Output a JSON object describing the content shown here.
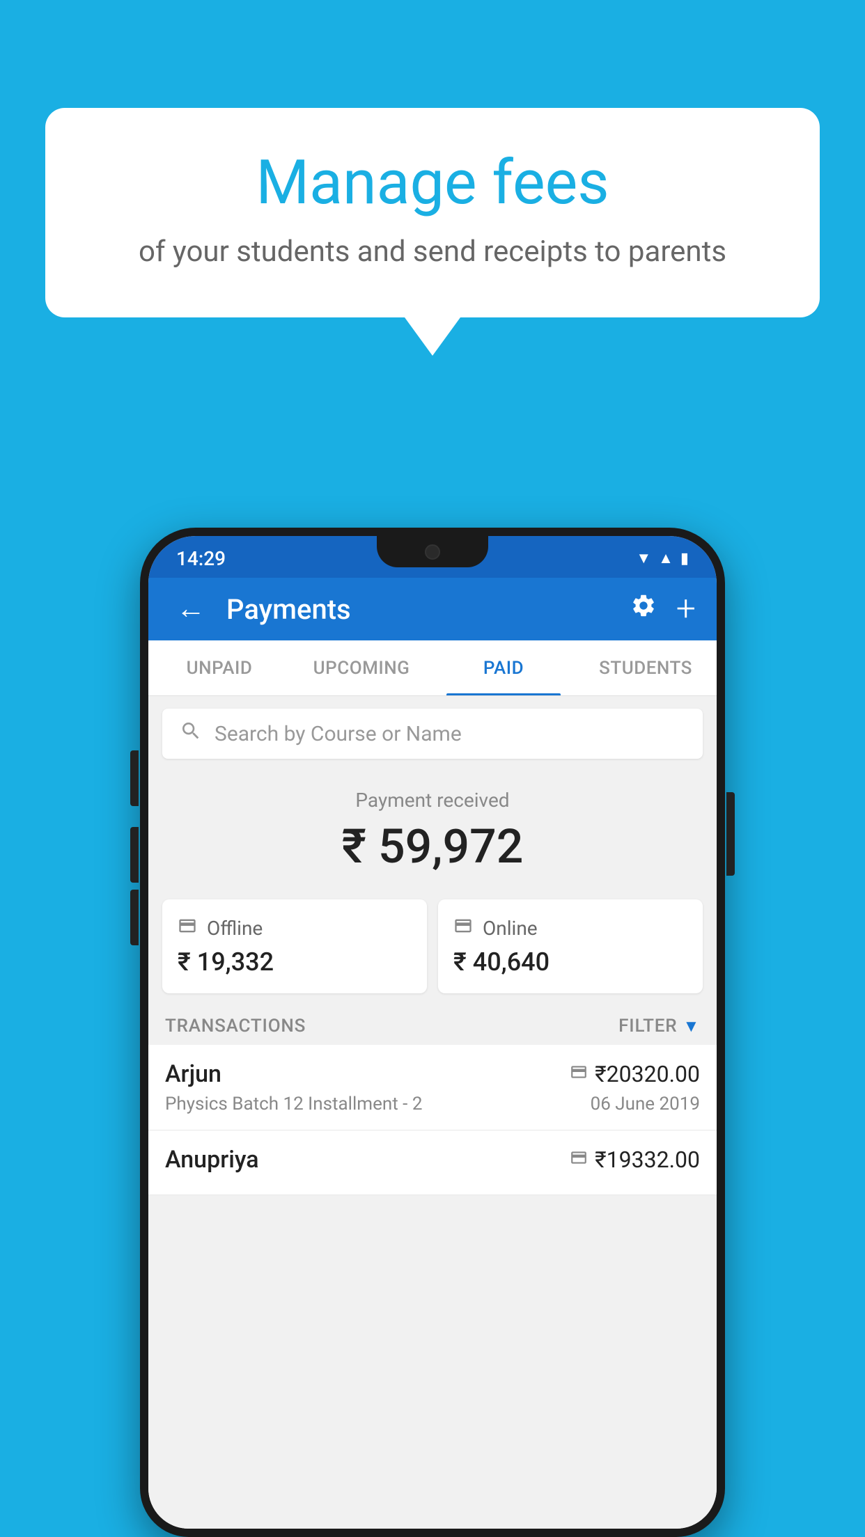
{
  "background_color": "#1AAFE3",
  "speech_bubble": {
    "title": "Manage fees",
    "subtitle": "of your students and send receipts to parents"
  },
  "phone": {
    "status_bar": {
      "time": "14:29"
    },
    "app_bar": {
      "title": "Payments",
      "back_label": "←",
      "settings_label": "⚙",
      "add_label": "+"
    },
    "tabs": [
      {
        "label": "UNPAID",
        "active": false
      },
      {
        "label": "UPCOMING",
        "active": false
      },
      {
        "label": "PAID",
        "active": true
      },
      {
        "label": "STUDENTS",
        "active": false
      }
    ],
    "search": {
      "placeholder": "Search by Course or Name"
    },
    "payment_received": {
      "label": "Payment received",
      "amount": "₹ 59,972"
    },
    "payment_cards": [
      {
        "type": "Offline",
        "amount": "₹ 19,332",
        "icon": "offline"
      },
      {
        "type": "Online",
        "amount": "₹ 40,640",
        "icon": "online"
      }
    ],
    "transactions_header": {
      "label": "TRANSACTIONS",
      "filter_label": "FILTER"
    },
    "transactions": [
      {
        "name": "Arjun",
        "course": "Physics Batch 12 Installment - 2",
        "amount": "₹20320.00",
        "date": "06 June 2019",
        "type": "online"
      },
      {
        "name": "Anupriya",
        "course": "",
        "amount": "₹19332.00",
        "date": "",
        "type": "offline"
      }
    ]
  }
}
